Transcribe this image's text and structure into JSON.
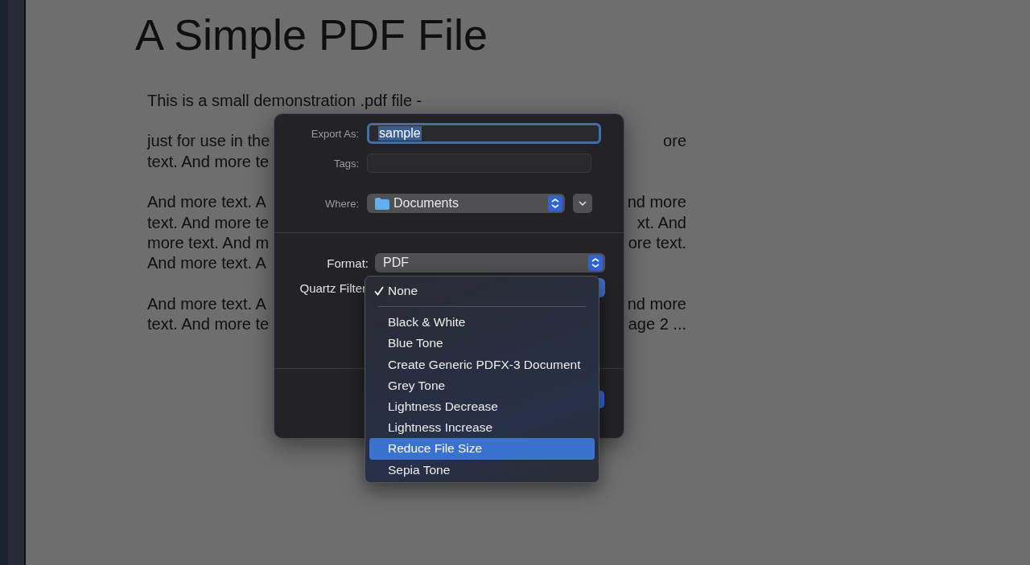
{
  "document": {
    "title": "A Simple PDF File",
    "paragraphs": [
      [
        {
          "left": "This is a small demonstration .pdf file -"
        }
      ],
      [
        {
          "left": "just for use in the",
          "right": "ore"
        },
        {
          "left": "text. And more te"
        }
      ],
      [
        {
          "left": "And more text. A",
          "right": "nd more"
        },
        {
          "left": "text. And more te",
          "right": "xt. And"
        },
        {
          "left": "more text. And m",
          "right": "ore text."
        },
        {
          "left": "And more text. A"
        }
      ],
      [
        {
          "left": "And more text. A",
          "right": "nd more"
        },
        {
          "left": "text. And more te",
          "right": "age 2 ..."
        }
      ]
    ]
  },
  "dialog": {
    "export_as": {
      "label": "Export As:",
      "value": "sample"
    },
    "tags": {
      "label": "Tags:"
    },
    "where": {
      "label": "Where:",
      "value": "Documents"
    },
    "format": {
      "label": "Format:",
      "value": "PDF"
    },
    "quartz_filter": {
      "label": "Quartz Filter"
    }
  },
  "menu": {
    "items": [
      {
        "kind": "item",
        "label": "None",
        "checked": true,
        "selected": false
      },
      {
        "kind": "separator"
      },
      {
        "kind": "item",
        "label": "Black & White",
        "checked": false,
        "selected": false
      },
      {
        "kind": "item",
        "label": "Blue Tone",
        "checked": false,
        "selected": false
      },
      {
        "kind": "item",
        "label": "Create Generic PDFX-3 Document",
        "checked": false,
        "selected": false
      },
      {
        "kind": "item",
        "label": "Grey Tone",
        "checked": false,
        "selected": false
      },
      {
        "kind": "item",
        "label": "Lightness Decrease",
        "checked": false,
        "selected": false
      },
      {
        "kind": "item",
        "label": "Lightness Increase",
        "checked": false,
        "selected": false
      },
      {
        "kind": "item",
        "label": "Reduce File Size",
        "checked": false,
        "selected": true
      },
      {
        "kind": "item",
        "label": "Sepia Tone",
        "checked": false,
        "selected": false
      }
    ]
  }
}
